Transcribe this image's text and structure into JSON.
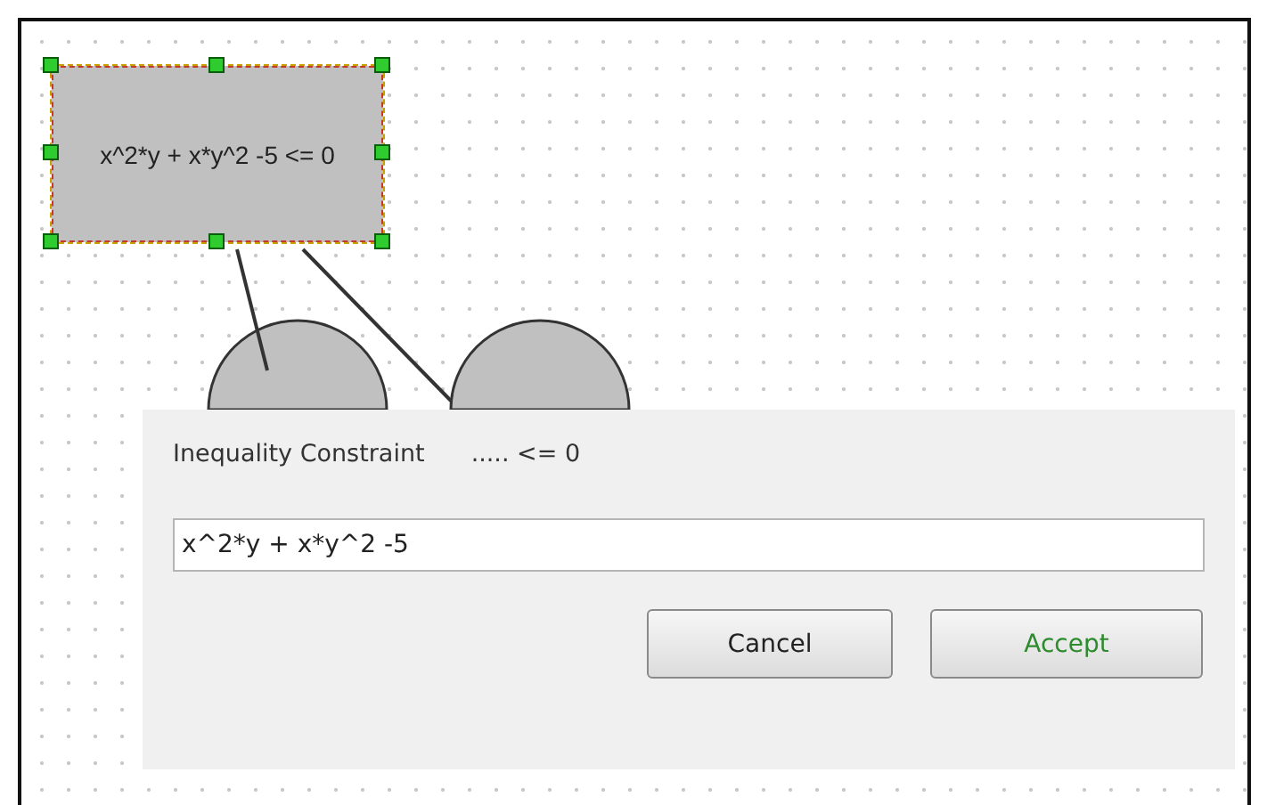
{
  "canvas": {
    "node": {
      "label": "x^2*y + x*y^2 -5 <= 0",
      "selected": true
    }
  },
  "dialog": {
    "title": "Inequality Constraint",
    "hint": "..... <= 0",
    "value": "x^2*y + x*y^2 -5",
    "buttons": [
      {
        "label": "Cancel",
        "kind": "normal"
      },
      {
        "label": "Accept",
        "kind": "primary"
      }
    ]
  }
}
